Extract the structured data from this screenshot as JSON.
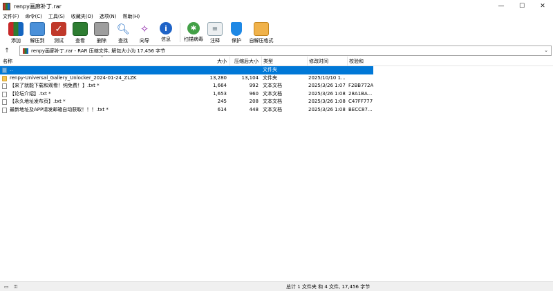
{
  "window": {
    "title": "renpy画廊补丁.rar",
    "minimize": "—",
    "maximize": "☐",
    "close": "✕"
  },
  "menu": [
    "文件(F)",
    "命令(C)",
    "工具(S)",
    "收藏夹(O)",
    "选项(N)",
    "帮助(H)"
  ],
  "toolbar": {
    "add": "添加",
    "extract": "解压到",
    "test": "测试",
    "view": "查看",
    "delete": "删除",
    "find": "查找",
    "wizard": "向导",
    "info": "信息",
    "scan": "扫描病毒",
    "comment": "注释",
    "protect": "保护",
    "sfx": "自解压格式"
  },
  "path": {
    "up": "↑",
    "text": "renpy画廊补丁.rar - RAR 压缩文件, 解包大小为 17,456 字节",
    "dropdown": "⌄"
  },
  "columns": {
    "name": "名称",
    "size": "大小",
    "packed": "压缩后大小",
    "type": "类型",
    "modified": "修改时间",
    "crc": "校验和",
    "sort_arrow": "^"
  },
  "rows": [
    {
      "name": "..",
      "size": "",
      "packed": "",
      "type": "文件夹",
      "modified": "",
      "crc": ""
    },
    {
      "name": "renpy-Universal_Gallery_Unlocker_2024-01-24_ZLZK",
      "size": "13,280",
      "packed": "13,104",
      "type": "文件夹",
      "modified": "2025/10/10 1...",
      "crc": ""
    },
    {
      "name": "【来了就能下载和观看！纯免费！】.txt *",
      "size": "1,664",
      "packed": "992",
      "type": "文本文档",
      "modified": "2025/3/26 1:07",
      "crc": "F2BB772A"
    },
    {
      "name": "【论坛介绍】.txt *",
      "size": "1,653",
      "packed": "960",
      "type": "文本文档",
      "modified": "2025/3/26 1:08",
      "crc": "28A1BA..."
    },
    {
      "name": "【永久地址发布页】.txt *",
      "size": "245",
      "packed": "208",
      "type": "文本文档",
      "modified": "2025/3/26 1:08",
      "crc": "C47FF777"
    },
    {
      "name": "最新地址及APP请发邮箱自动获取！！！.txt *",
      "size": "614",
      "packed": "448",
      "type": "文本文档",
      "modified": "2025/3/26 1:08",
      "crc": "BECC87..."
    }
  ],
  "status": {
    "icon": "▭",
    "key": "⚿",
    "text": "总计 1 文件夹 和 4 文件, 17,456 字节"
  }
}
